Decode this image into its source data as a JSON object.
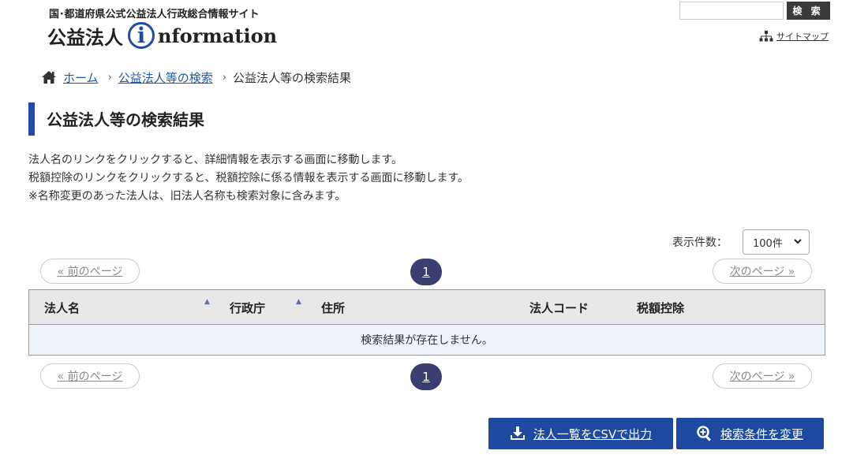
{
  "header": {
    "tagline": "国･都道府県公式公益法人行政総合情報サイト",
    "logo_left": "公益法人",
    "logo_i": "i",
    "logo_right": "nformation",
    "search_placeholder": "",
    "search_button": "検 索",
    "sitemap_label": "サイトマップ"
  },
  "breadcrumb": {
    "home": "ホーム",
    "sep": "›",
    "search": "公益法人等の検索",
    "current": "公益法人等の検索結果"
  },
  "page": {
    "title": "公益法人等の検索結果",
    "desc": [
      "法人名のリンクをクリックすると、詳細情報を表示する画面に移動します。",
      "税額控除のリンクをクリックすると、税額控除に係る情報を表示する画面に移動します。",
      "※名称変更のあった法人は、旧法人名称も検索対象に含みます。"
    ]
  },
  "per_page": {
    "label": "表示件数：",
    "value": "100件"
  },
  "pager": {
    "prev": "« 前のページ",
    "current": "1",
    "next": "次のページ »"
  },
  "table": {
    "columns": [
      "法人名",
      "行政庁",
      "住所",
      "法人コード",
      "税額控除"
    ],
    "sort_glyph": "▲",
    "empty": "検索結果が存在しません。"
  },
  "actions": {
    "csv": "法人一覧をCSVで出力",
    "change": "検索条件を変更"
  },
  "colors": {
    "accent": "#1e4ba3",
    "button": "#1d4aa0",
    "pager_current": "#3a3f72"
  }
}
